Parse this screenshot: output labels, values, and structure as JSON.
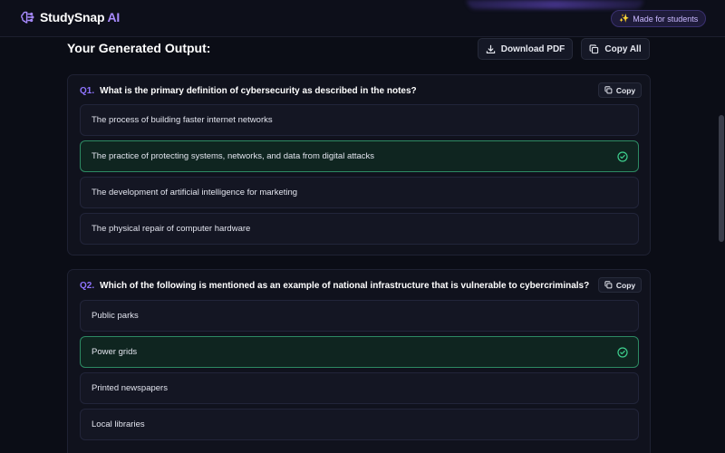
{
  "app": {
    "name_main": "StudySnap",
    "name_accent": "AI",
    "badge_icon": "sparkles-icon",
    "badge": "Made for students"
  },
  "output": {
    "heading": "Your Generated Output:",
    "download_label": "Download PDF",
    "copy_all_label": "Copy All"
  },
  "questions": [
    {
      "number": "Q1.",
      "text": "What is the primary definition of cybersecurity as described in the notes?",
      "copy_label": "Copy",
      "options": [
        "The process of building faster internet networks",
        "The practice of protecting systems, networks, and data from digital attacks",
        "The development of artificial intelligence for marketing",
        "The physical repair of computer hardware"
      ],
      "correct_index": 1
    },
    {
      "number": "Q2.",
      "text": "Which of the following is mentioned as an example of national infrastructure that is vulnerable to cybercriminals?",
      "copy_label": "Copy",
      "options": [
        "Public parks",
        "Power grids",
        "Printed newspapers",
        "Local libraries"
      ],
      "correct_index": 1
    }
  ],
  "colors": {
    "background": "#0b0d16",
    "accent": "#8f74ff",
    "correct_border": "#2d8a63",
    "correct_icon": "#3ecf8e"
  }
}
